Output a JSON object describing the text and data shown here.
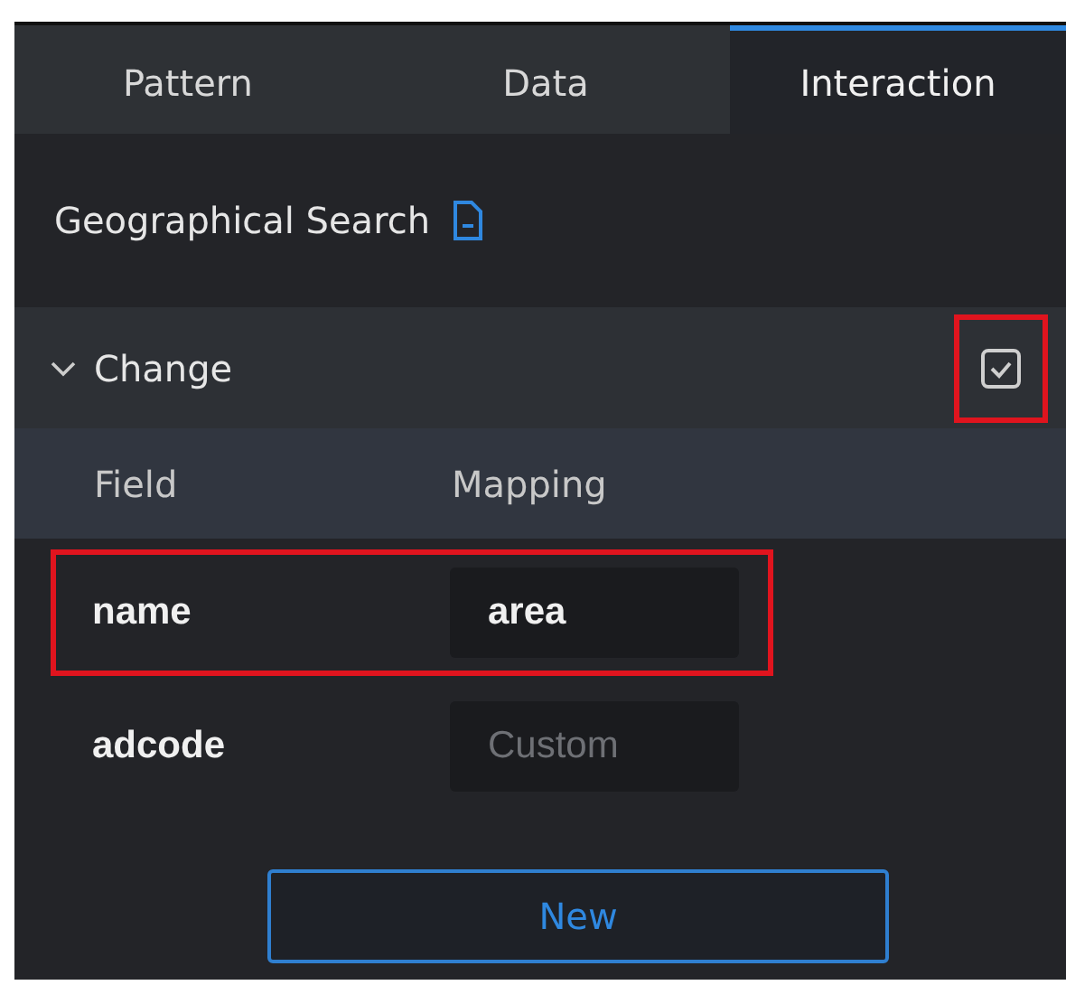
{
  "tabs": [
    {
      "label": "Pattern",
      "selected": false
    },
    {
      "label": "Data",
      "selected": false
    },
    {
      "label": "Interaction",
      "selected": true
    }
  ],
  "title": "Geographical Search",
  "section": {
    "label": "Change",
    "expanded": true,
    "enabled": {
      "checked": true,
      "highlighted": true
    }
  },
  "table": {
    "columns": [
      "Field",
      "Mapping"
    ],
    "rows": [
      {
        "field": "name",
        "value": "area",
        "highlighted": true
      },
      {
        "field": "adcode",
        "placeholder": "Custom",
        "highlighted": false
      }
    ]
  },
  "button": "New"
}
